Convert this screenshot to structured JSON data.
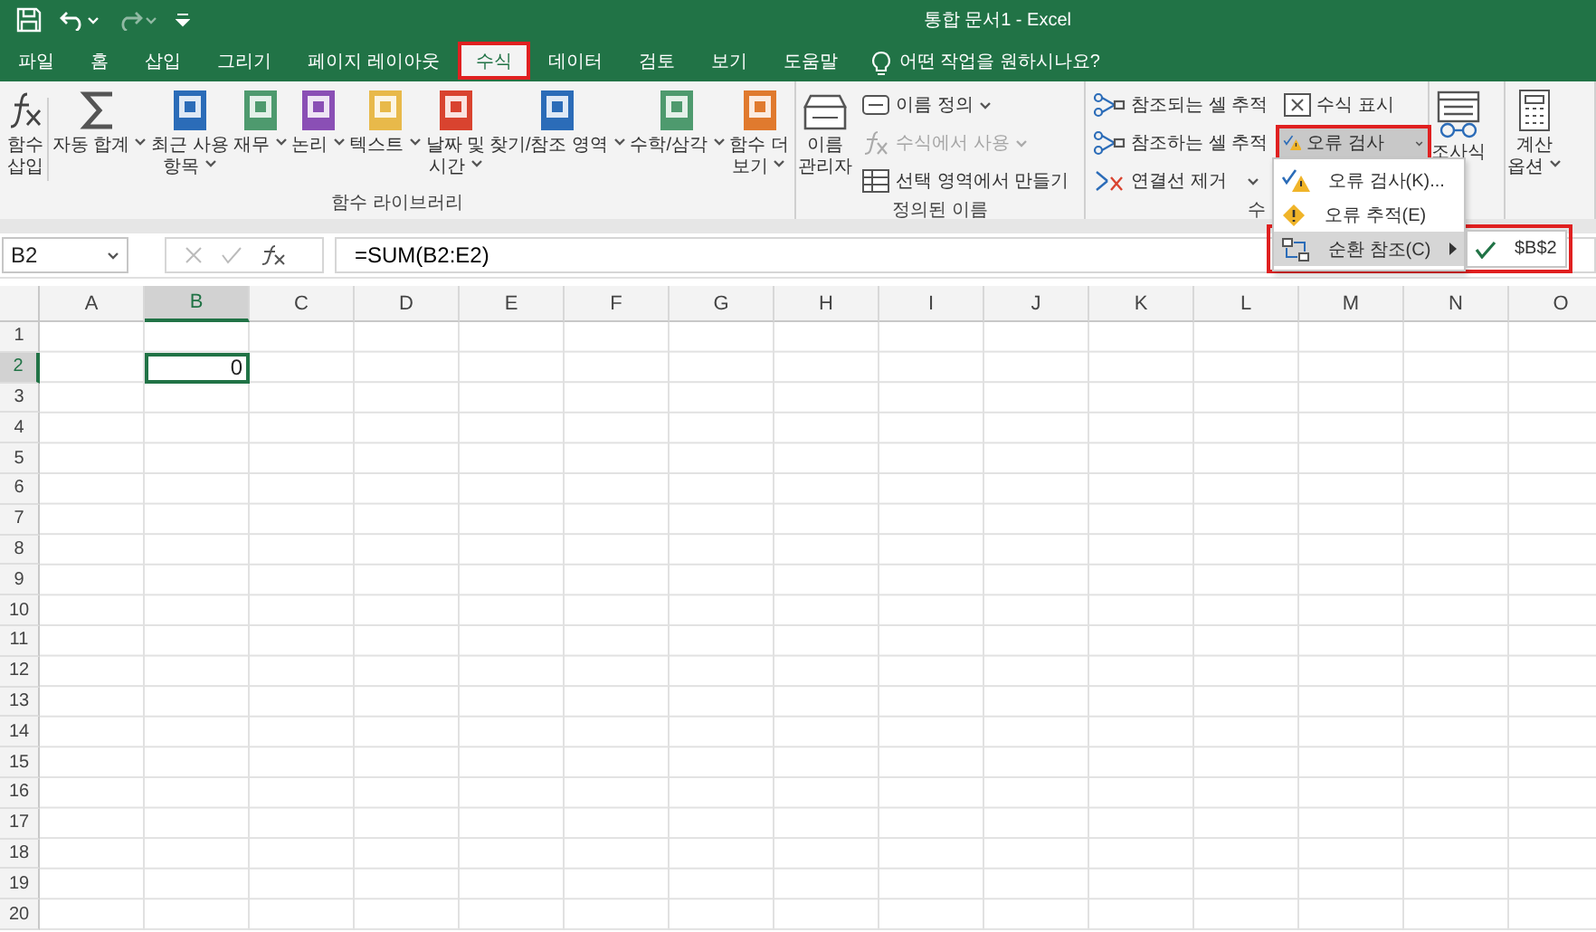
{
  "window": {
    "title": "통합 문서1  -  Excel"
  },
  "quick_access": [
    {
      "kind": "save",
      "has_menu": false,
      "disabled": false
    },
    {
      "kind": "undo",
      "has_menu": true,
      "disabled": false
    },
    {
      "kind": "redo",
      "has_menu": true,
      "disabled": true
    },
    {
      "kind": "customize",
      "has_menu": false,
      "disabled": false
    }
  ],
  "tabs": [
    {
      "label": "파일",
      "selected": false,
      "highlighted": false
    },
    {
      "label": "홈",
      "selected": false,
      "highlighted": false
    },
    {
      "label": "삽입",
      "selected": false,
      "highlighted": false
    },
    {
      "label": "그리기",
      "selected": false,
      "highlighted": false
    },
    {
      "label": "페이지 레이아웃",
      "selected": false,
      "highlighted": false
    },
    {
      "label": "수식",
      "selected": true,
      "highlighted": true
    },
    {
      "label": "데이터",
      "selected": false,
      "highlighted": false
    },
    {
      "label": "검토",
      "selected": false,
      "highlighted": false
    },
    {
      "label": "보기",
      "selected": false,
      "highlighted": false
    },
    {
      "label": "도움말",
      "selected": false,
      "highlighted": false
    }
  ],
  "tell_me": {
    "placeholder": "어떤 작업을 원하시나요?"
  },
  "ribbon": {
    "function_library": {
      "label": "함수 라이브러리",
      "buttons": [
        {
          "label": "함수\n삽입",
          "kind": "fx",
          "has_menu": false
        },
        {
          "label": "자동 합계",
          "kind": "sigma",
          "has_menu": true
        },
        {
          "label": "최근 사용\n항목",
          "kind": "book",
          "color": "#2b6cb8",
          "has_menu": true
        },
        {
          "label": "재무",
          "kind": "book",
          "color": "#4e9a6e",
          "has_menu": true
        },
        {
          "label": "논리",
          "kind": "book",
          "color": "#8a4fb5",
          "has_menu": true
        },
        {
          "label": "텍스트",
          "kind": "book",
          "color": "#e8b94a",
          "has_menu": true
        },
        {
          "label": "날짜 및\n시간",
          "kind": "book",
          "color": "#d9432f",
          "has_menu": true
        },
        {
          "label": "찾기/참조 영역",
          "kind": "book",
          "color": "#2b6cb8",
          "has_menu": true
        },
        {
          "label": "수학/삼각",
          "kind": "book",
          "color": "#4e9a6e",
          "has_menu": true
        },
        {
          "label": "함수 더\n보기",
          "kind": "book",
          "color": "#e07a2e",
          "has_menu": true
        }
      ]
    },
    "defined_names": {
      "label": "정의된 이름",
      "manager": {
        "label": "이름\n관리자"
      },
      "commands": [
        {
          "label": "이름 정의",
          "kind": "tag",
          "has_menu": true,
          "disabled": false
        },
        {
          "label": "수식에서 사용",
          "kind": "function",
          "has_menu": true,
          "disabled": true
        },
        {
          "label": "선택 영역에서 만들기",
          "kind": "table",
          "has_menu": false,
          "disabled": false
        }
      ]
    },
    "formula_auditing": {
      "label": "수",
      "trace_commands": [
        {
          "label": "참조되는 셀 추적",
          "kind": "trace",
          "has_menu": false
        },
        {
          "label": "참조하는 셀 추적",
          "kind": "trace",
          "has_menu": false
        },
        {
          "label": "연결선 제거",
          "kind": "remove",
          "has_menu": true
        }
      ],
      "show_formulas": {
        "label": "수식 표시"
      },
      "error_checking": {
        "label": "오류 검사",
        "expanded": true,
        "highlighted": true
      }
    },
    "watch_window": {
      "label": "조사식"
    },
    "calculation": {
      "label": "계산\n옵션"
    }
  },
  "error_menu": {
    "items": [
      {
        "label": "오류 검사(K)...",
        "kind": "check",
        "selected": false,
        "has_submenu": false,
        "highlighted": false
      },
      {
        "label": "오류 추적(E)",
        "kind": "warning",
        "selected": false,
        "has_submenu": false,
        "highlighted": false
      },
      {
        "label": "순환 참조(C)",
        "kind": "circular",
        "selected": true,
        "has_submenu": true,
        "highlighted": true
      }
    ],
    "submenu": [
      {
        "label": "$B$2",
        "checked": true
      }
    ]
  },
  "formula_bar": {
    "name_box": "B2",
    "formula": "=SUM(B2:E2)"
  },
  "sheet": {
    "columns": [
      {
        "label": "A",
        "selected": false
      },
      {
        "label": "B",
        "selected": true
      },
      {
        "label": "C",
        "selected": false
      },
      {
        "label": "D",
        "selected": false
      },
      {
        "label": "E",
        "selected": false
      },
      {
        "label": "F",
        "selected": false
      },
      {
        "label": "G",
        "selected": false
      },
      {
        "label": "H",
        "selected": false
      },
      {
        "label": "I",
        "selected": false
      },
      {
        "label": "J",
        "selected": false
      },
      {
        "label": "K",
        "selected": false
      },
      {
        "label": "L",
        "selected": false
      },
      {
        "label": "M",
        "selected": false
      },
      {
        "label": "N",
        "selected": false
      },
      {
        "label": "O",
        "selected": false
      }
    ],
    "rows": [
      {
        "label": "1",
        "selected": false
      },
      {
        "label": "2",
        "selected": true,
        "cells": [
          null,
          {
            "value": "0",
            "selected": true
          }
        ]
      },
      {
        "label": "3",
        "selected": false
      },
      {
        "label": "4",
        "selected": false
      },
      {
        "label": "5",
        "selected": false
      },
      {
        "label": "6",
        "selected": false
      },
      {
        "label": "7",
        "selected": false
      },
      {
        "label": "8",
        "selected": false
      },
      {
        "label": "9",
        "selected": false
      },
      {
        "label": "10",
        "selected": false
      },
      {
        "label": "11",
        "selected": false
      },
      {
        "label": "12",
        "selected": false
      },
      {
        "label": "13",
        "selected": false
      },
      {
        "label": "14",
        "selected": false
      },
      {
        "label": "15",
        "selected": false
      },
      {
        "label": "16",
        "selected": false
      },
      {
        "label": "17",
        "selected": false
      },
      {
        "label": "18",
        "selected": false
      },
      {
        "label": "19",
        "selected": false
      },
      {
        "label": "20",
        "selected": false
      }
    ]
  }
}
